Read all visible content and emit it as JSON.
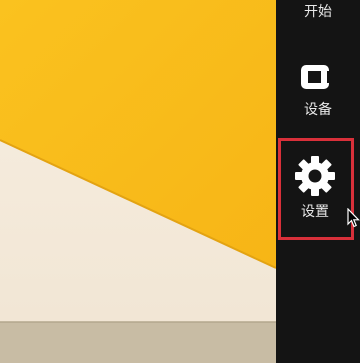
{
  "charms": {
    "start_label": "开始",
    "devices_label": "设备",
    "settings_label": "设置",
    "devices_icon": "devices-icon",
    "settings_icon": "gear-icon"
  },
  "colors": {
    "charms_background": "#141414",
    "highlight_border": "#d9303a",
    "wallpaper_yellow": "#f9b81a",
    "wallpaper_cream": "#f5ecdd"
  }
}
